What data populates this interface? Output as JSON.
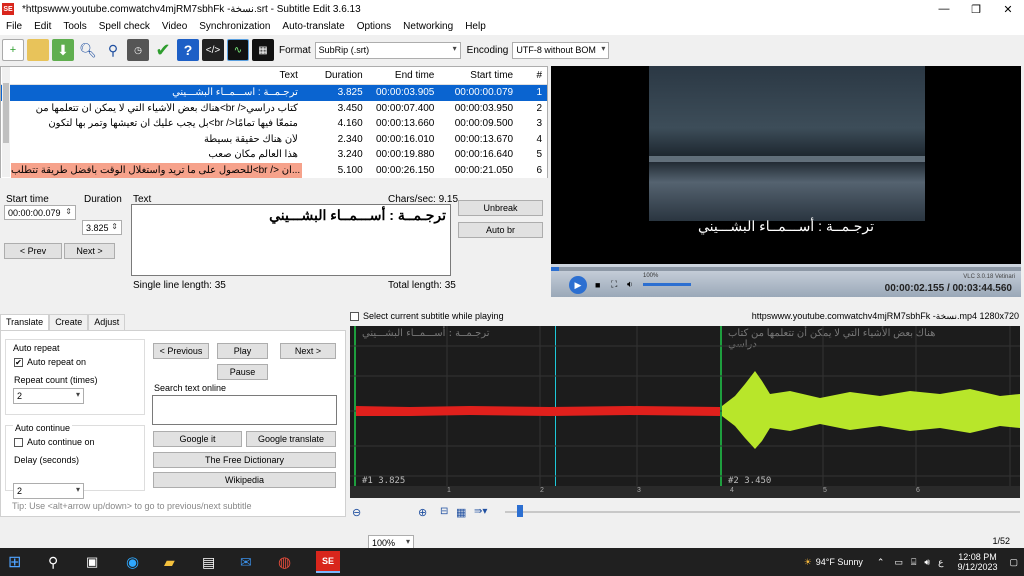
{
  "window": {
    "title": "*httpswww.youtube.comwatchv4mjRM7sbhFk -نسخة.srt - Subtitle Edit 3.6.13",
    "app_icon": "SE"
  },
  "menu": [
    "File",
    "Edit",
    "Tools",
    "Spell check",
    "Video",
    "Synchronization",
    "Auto-translate",
    "Options",
    "Networking",
    "Help"
  ],
  "toolbar": {
    "format_label": "Format",
    "format_value": "SubRip (.srt)",
    "encoding_label": "Encoding",
    "encoding_value": "UTF-8 without BOM"
  },
  "grid": {
    "headers": {
      "text": "Text",
      "duration": "Duration",
      "end": "End time",
      "start": "Start time",
      "num": "#"
    },
    "rows": [
      {
        "text": "ترجـمــة : أســـمــاء البشـــيني",
        "duration": "3.825",
        "end": "00:00:03.905",
        "start": "00:00:00.079",
        "num": "1"
      },
      {
        "text": "هناك بعض الأشياء التي لا يمكن أن تتعلمها من<br />كتاب دراسي",
        "duration": "3.450",
        "end": "00:00:07.400",
        "start": "00:00:03.950",
        "num": "2"
      },
      {
        "text": "بل يجب عليك أن تعيشها وتمر بها لتكون<br />متمعًّا فيها تمامًا",
        "duration": "4.160",
        "end": "00:00:13.660",
        "start": "00:00:09.500",
        "num": "3"
      },
      {
        "text": "لأن هناك حقيقة بسيطة",
        "duration": "2.340",
        "end": "00:00:16.010",
        "start": "00:00:13.670",
        "num": "4"
      },
      {
        "text": "هذا العالم مكان صعب",
        "duration": "3.240",
        "end": "00:00:19.880",
        "start": "00:00:16.640",
        "num": "5"
      },
      {
        "text": "للحصول على ما تريد واستغلال الوقت بأفضل طريقة تتطلب<br /> أن...",
        "duration": "5.100",
        "end": "00:00:26.150",
        "start": "00:00:21.050",
        "num": "6"
      }
    ]
  },
  "editor": {
    "start_label": "Start time",
    "start_value": "00:00:00.079",
    "duration_label": "Duration",
    "duration_value": "3.825",
    "text_label": "Text",
    "chars_sec": "Chars/sec: 9.15",
    "text_value": "ترجـمــة : أســـمــاء البشـــيني",
    "unbreak": "Unbreak",
    "auto_br": "Auto br",
    "prev": "< Prev",
    "next": "Next >",
    "single_line": "Single line length: 35",
    "total_length": "Total length: 35"
  },
  "video": {
    "subtitle": "ترجـمــة : أســـمــاء البشـــيني",
    "time": "00:00:02.155 / 00:03:44.560",
    "vlc": "VLC 3.0.18 Vetinari",
    "volume": "100%"
  },
  "tabs": [
    "Translate",
    "Create",
    "Adjust"
  ],
  "translate": {
    "auto_repeat_group": "Auto repeat",
    "auto_repeat_on": "Auto repeat on",
    "repeat_count_label": "Repeat count (times)",
    "repeat_count": "2",
    "auto_continue_group": "Auto continue",
    "auto_continue_on": "Auto continue on",
    "delay_label": "Delay (seconds)",
    "delay": "2",
    "prev": "< Previous",
    "play": "Play",
    "next": "Next >",
    "pause": "Pause",
    "search_label": "Search text online",
    "google_it": "Google it",
    "google_translate": "Google translate",
    "free_dictionary": "The Free Dictionary",
    "wikipedia": "Wikipedia",
    "tip": "Tip: Use <alt+arrow up/down> to go to previous/next subtitle"
  },
  "waveform": {
    "select_label": "Select current subtitle while playing",
    "file_info": "httpswww.youtube.comwatchv4mjRM7sbhFk -نسخة.mp4 1280x720",
    "sub1_text": "ترجـمــة : أســـمــاء البشـــيني",
    "sub2_text": "هناك بعض الأشياء التي لا يمكن أن تتعلمها من كتاب دراسي",
    "sub1_label": "#1  3.825",
    "sub2_label": "#2  3.450",
    "ticks": [
      "1",
      "2",
      "3",
      "4",
      "5",
      "6"
    ],
    "zoom": "100%",
    "colors": {
      "sub1": "#e0201c",
      "sub2": "#b8e62a",
      "bg": "#1c1c1c"
    }
  },
  "status": {
    "position": "1/52"
  },
  "taskbar": {
    "weather": "94°F  Sunny",
    "lang": "ع",
    "time": "12:08 PM",
    "date": "9/12/2023"
  }
}
